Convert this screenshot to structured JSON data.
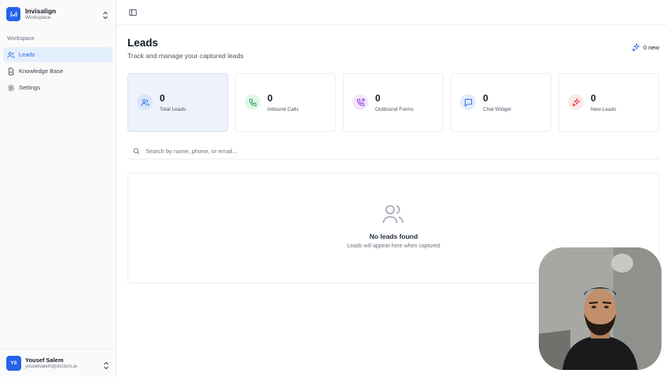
{
  "workspace": {
    "name": "Invisalign",
    "subtitle": "Workspace"
  },
  "sidebar": {
    "section_label": "Workspace",
    "items": [
      {
        "label": "Leads",
        "icon": "users-icon",
        "active": true
      },
      {
        "label": "Knowledge Base",
        "icon": "document-icon",
        "active": false
      },
      {
        "label": "Settings",
        "icon": "gear-icon",
        "active": false
      }
    ]
  },
  "user": {
    "initials": "YS",
    "name": "Yousef Salem",
    "email": "yousefsalem@doctors.ai"
  },
  "page": {
    "title": "Leads",
    "subtitle": "Track and manage your captured leads"
  },
  "new_badge": {
    "label": "0 new",
    "icon": "sparkle-icon"
  },
  "stats": [
    {
      "value": "0",
      "label": "Total Leads",
      "icon": "users-icon",
      "color": "#2563eb"
    },
    {
      "value": "0",
      "label": "Inbound Calls",
      "icon": "phone-icon",
      "color": "#16a34a"
    },
    {
      "value": "0",
      "label": "Outbound Forms",
      "icon": "phone-outgoing-icon",
      "color": "#9333ea"
    },
    {
      "value": "0",
      "label": "Chat Widget",
      "icon": "chat-icon",
      "color": "#2563eb"
    },
    {
      "value": "0",
      "label": "New Leads",
      "icon": "sparkle-icon",
      "color": "#dc2626"
    }
  ],
  "search": {
    "placeholder": "Search by name, phone, or email...",
    "value": ""
  },
  "empty_state": {
    "title": "No leads found",
    "subtitle": "Leads will appear here when captured",
    "icon": "users-icon"
  },
  "colors": {
    "accent": "#2563eb",
    "active_nav_bg": "#e4effd",
    "card_active_bg": "#eef2fb"
  }
}
